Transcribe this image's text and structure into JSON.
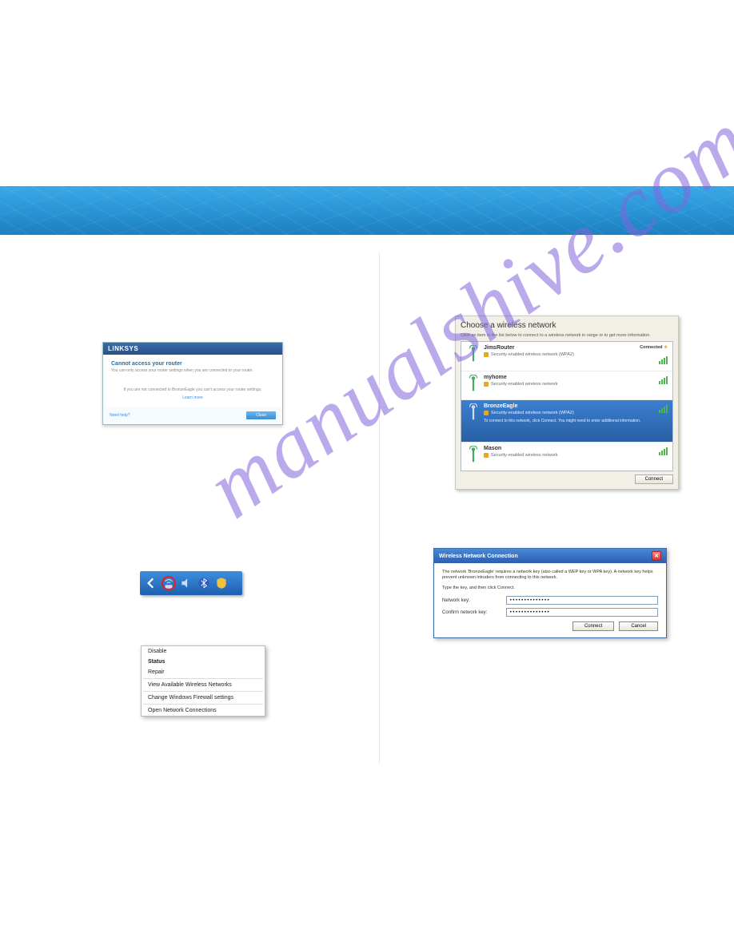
{
  "watermark": "manualshive.com",
  "linksys": {
    "brand": "LINKSYS",
    "title": "Cannot access your router",
    "subtitle": "You can only access your router settings when you are connected to your router.",
    "message": "If you are not connected to BronzeEagle you can't access your router settings.",
    "learn": "Learn more",
    "help": "Need help?",
    "close": "Close"
  },
  "context_menu": {
    "items": [
      "Disable",
      "Status",
      "Repair"
    ],
    "items2": [
      "View Available Wireless Networks"
    ],
    "items3": [
      "Change Windows Firewall settings"
    ],
    "items4": [
      "Open Network Connections"
    ]
  },
  "wireless": {
    "title": "Choose a wireless network",
    "subtitle": "Click an item in the list below to connect to a wireless network in range or to get more information.",
    "connected_label": "Connected",
    "connect_button": "Connect",
    "networks": [
      {
        "name": "JimsRouter",
        "security": "Security-enabled wireless network (WPA2)",
        "connected": true
      },
      {
        "name": "myhome",
        "security": "Security-enabled wireless network",
        "connected": false
      },
      {
        "name": "BronzeEagle",
        "security": "Security-enabled wireless network (WPA2)",
        "selected": true,
        "hint": "To connect to this network, click Connect. You might need to enter additional information."
      },
      {
        "name": "Mason",
        "security": "Security-enabled wireless network",
        "connected": false
      }
    ]
  },
  "key_dialog": {
    "title": "Wireless Network Connection",
    "message": "The network 'BronzeEagle' requires a network key (also called a WEP key or WPA key). A network key helps prevent unknown intruders from connecting to this network.",
    "prompt": "Type the key, and then click Connect.",
    "label_key": "Network key:",
    "label_confirm": "Confirm network key:",
    "value": "••••••••••••••",
    "connect": "Connect",
    "cancel": "Cancel"
  }
}
